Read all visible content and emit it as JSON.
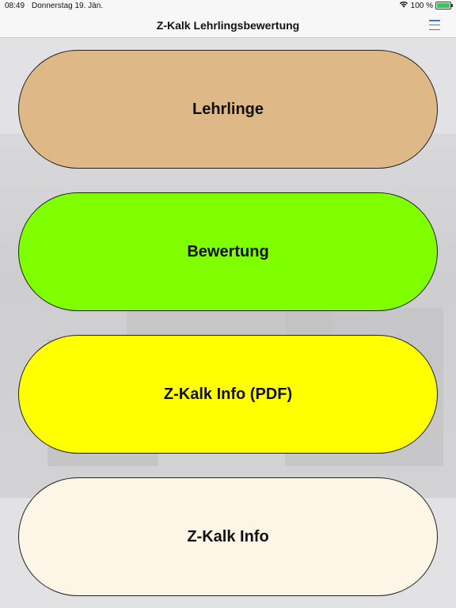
{
  "status_bar": {
    "time": "08:49",
    "date": "Donnerstag 19. Jän.",
    "battery_text": "100 %",
    "battery_level": 1.0
  },
  "nav": {
    "title": "Z-Kalk Lehrlingsbewertung",
    "menu_icon": "hamburger-menu-icon"
  },
  "menu_buttons": [
    {
      "label": "Lehrlinge",
      "color": "#deb887"
    },
    {
      "label": "Bewertung",
      "color": "#7fff00"
    },
    {
      "label": "Z-Kalk Info (PDF)",
      "color": "#ffff00"
    },
    {
      "label": "Z-Kalk Info",
      "color": "#fdf5e6"
    }
  ],
  "colors": {
    "accent": "#3478f6",
    "battery_fill": "#35c759"
  }
}
